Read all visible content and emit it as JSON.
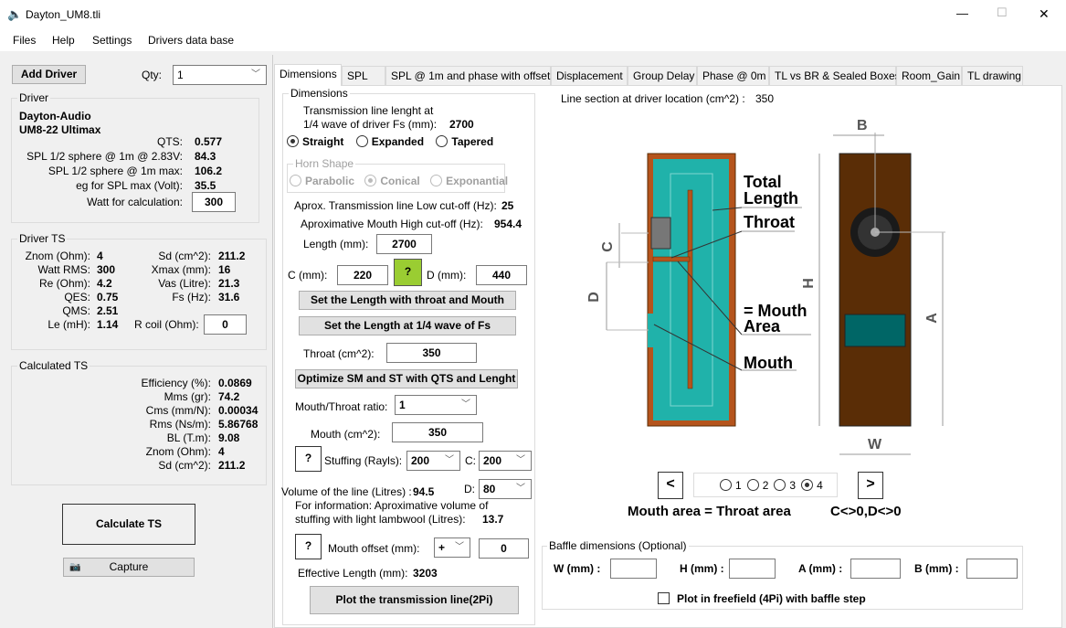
{
  "window": {
    "title": "Dayton_UM8.tli",
    "minimize": "—",
    "maximize": "☐",
    "close": "✕"
  },
  "menu": [
    "Files",
    "Help",
    "Settings",
    "Drivers data base"
  ],
  "left": {
    "add_driver": "Add Driver",
    "qty_label": "Qty:",
    "qty_value": "1",
    "driver": {
      "legend": "Driver",
      "brand": "Dayton-Audio",
      "model": "UM8-22 Ultimax",
      "rows": [
        {
          "label": "QTS:",
          "value": "0.577"
        },
        {
          "label": "SPL 1/2 sphere @ 1m @ 2.83V:",
          "value": "84.3"
        },
        {
          "label": "SPL 1/2 sphere @ 1m max:",
          "value": "106.2"
        },
        {
          "label": "eg for SPL max (Volt):",
          "value": "35.5"
        }
      ],
      "watt_label": "Watt for calculation:",
      "watt_value": "300"
    },
    "driver_ts": {
      "legend": "Driver TS",
      "left_rows": [
        {
          "label": "Znom (Ohm):",
          "value": "4"
        },
        {
          "label": "Watt RMS:",
          "value": "300"
        },
        {
          "label": "Re (Ohm):",
          "value": "4.2"
        },
        {
          "label": "QES:",
          "value": "0.75"
        },
        {
          "label": "QMS:",
          "value": "2.51"
        },
        {
          "label": "Le (mH):",
          "value": "1.14"
        }
      ],
      "right_rows": [
        {
          "label": "Sd (cm^2):",
          "value": "211.2"
        },
        {
          "label": "Xmax (mm):",
          "value": "16"
        },
        {
          "label": "Vas (Litre):",
          "value": "21.3"
        },
        {
          "label": "Fs (Hz):",
          "value": "31.6"
        }
      ],
      "rcoil_label": "R coil (Ohm):",
      "rcoil_value": "0"
    },
    "calc_ts": {
      "legend": "Calculated TS",
      "rows": [
        {
          "label": "Efficiency (%):",
          "value": "0.0869"
        },
        {
          "label": "Mms (gr):",
          "value": "74.2"
        },
        {
          "label": "Cms (mm/N):",
          "value": "0.00034"
        },
        {
          "label": "Rms (Ns/m):",
          "value": "5.86768"
        },
        {
          "label": "BL (T.m):",
          "value": "9.08"
        },
        {
          "label": "Znom (Ohm):",
          "value": "4"
        },
        {
          "label": "Sd (cm^2):",
          "value": "211.2"
        }
      ]
    },
    "calculate": "Calculate TS",
    "capture": "Capture"
  },
  "tabs": [
    "Dimensions",
    "SPL",
    "SPL @ 1m and phase with offset",
    "Displacement",
    "Group Delay",
    "Phase @ 0m",
    "TL vs BR & Sealed Boxes",
    "Room_Gain",
    "TL drawing"
  ],
  "active_tab": "Dimensions",
  "dims": {
    "legend": "Dimensions",
    "tl_len_label1": "Transmission line lenght at",
    "tl_len_label2": "1/4 wave of driver Fs (mm):",
    "tl_len_value": "2700",
    "shapes": [
      "Straight",
      "Expanded",
      "Tapered"
    ],
    "shape_selected": "Straight",
    "horn_legend": "Horn Shape",
    "horn": [
      "Parabolic",
      "Conical",
      "Exponantial"
    ],
    "horn_selected": "Conical",
    "low_cut_label": "Aprox. Transmission line Low cut-off (Hz):",
    "low_cut_value": "25",
    "high_cut_label": "Aproximative Mouth High cut-off (Hz):",
    "high_cut_value": "954.4",
    "length_label": "Length (mm):",
    "length_value": "2700",
    "c_label": "C (mm):",
    "c_value": "220",
    "help": "?",
    "d_label": "D (mm):",
    "d_value": "440",
    "set_throat_mouth": "Set the  Length with throat and Mouth",
    "set_quarter": "Set the  Length at 1/4 wave of Fs",
    "throat_label": "Throat (cm^2):",
    "throat_value": "350",
    "optimize": "Optimize SM and ST with QTS and Lenght",
    "ratio_label": "Mouth/Throat ratio:",
    "ratio_value": "1",
    "mouth_label": "Mouth (cm^2):",
    "mouth_value": "350",
    "stuffing_label": "Stuffing (Rayls):",
    "stuffing_value": "200",
    "sc_label": "C:",
    "sc_value": "200",
    "volume_label": "Volume of the line (Litres) :",
    "volume_value": "94.5",
    "sd_label": "D:",
    "sd_value": "80",
    "info1": "For information: Aproximative volume of",
    "info2": "stuffing with light lambwool  (Litres):",
    "info_value": "13.7",
    "offset_label": "Mouth offset (mm):",
    "offset_sign": "+",
    "offset_value": "0",
    "eff_label": "Effective Length (mm):",
    "eff_value": "3203",
    "plot": "Plot the transmission line(2Pi)"
  },
  "drawing": {
    "section_label": "Line section at driver location (cm^2) :",
    "section_value": "350",
    "labels": {
      "total1": "Total",
      "total2": "Length",
      "throat": "Throat",
      "mouth1": "= Mouth",
      "mouth2": "Area",
      "mouth": "Mouth",
      "B": "B",
      "H": "H",
      "A": "A",
      "W": "W",
      "C": "C",
      "D": "D"
    },
    "prev": "<",
    "next": ">",
    "pages": [
      "1",
      "2",
      "3",
      "4"
    ],
    "page_selected": "4",
    "caption": "Mouth area = Throat area",
    "caption2": "C<>0,D<>0",
    "colors": {
      "wood": "#5a2d06",
      "wall": "#b5541c",
      "teal": "#20b2aa",
      "port": "#006666"
    }
  },
  "baffle": {
    "legend": "Baffle dimensions (Optional)",
    "w": "W (mm) :",
    "h": "H (mm) :",
    "a": "A (mm) :",
    "b": "B (mm) :",
    "freefield": "Plot in freefield (4Pi) with baffle step"
  }
}
